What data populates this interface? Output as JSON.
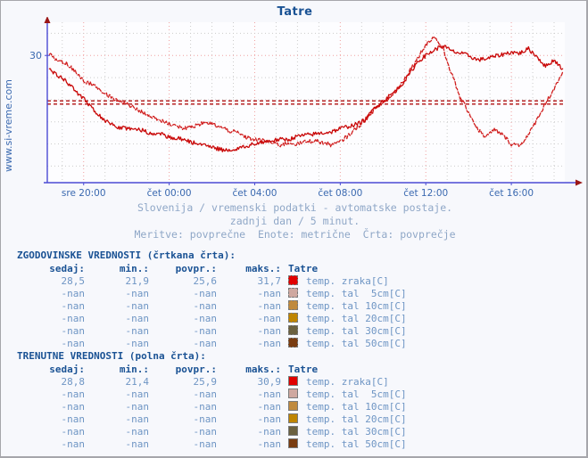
{
  "page": {
    "background": "#f7f8fc",
    "border_color": "#a6a6ab"
  },
  "header": {
    "title": "Tatre",
    "title_color": "#1a5294"
  },
  "watermark": {
    "text": "www.si-vreme.com",
    "color": "#3a69b0"
  },
  "caption": {
    "line1": "Slovenija / vremenski podatki - avtomatske postaje.",
    "line2": "zadnji dan / 5 minut.",
    "line3": "Meritve: povprečne  Enote: metrične  Črta: povprečje",
    "color": "#8fa7c7"
  },
  "tables": {
    "historical": {
      "heading": "ZGODOVINSKE VREDNOSTI (črtkana črta):",
      "line_style": "dashed",
      "columns": [
        "sedaj:",
        "min.:",
        "povpr.:",
        "maks.:"
      ],
      "series_header": "Tatre",
      "rows": [
        {
          "sedaj": "28,5",
          "min": "21,9",
          "povpr": "25,6",
          "maks": "31,7",
          "color": "#e00000",
          "label": "temp. zraka[C]"
        },
        {
          "sedaj": "-nan",
          "min": "-nan",
          "povpr": "-nan",
          "maks": "-nan",
          "color": "#cfa8a0",
          "label": "temp. tal  5cm[C]"
        },
        {
          "sedaj": "-nan",
          "min": "-nan",
          "povpr": "-nan",
          "maks": "-nan",
          "color": "#c08a3e",
          "label": "temp. tal 10cm[C]"
        },
        {
          "sedaj": "-nan",
          "min": "-nan",
          "povpr": "-nan",
          "maks": "-nan",
          "color": "#bf8500",
          "label": "temp. tal 20cm[C]"
        },
        {
          "sedaj": "-nan",
          "min": "-nan",
          "povpr": "-nan",
          "maks": "-nan",
          "color": "#6b6140",
          "label": "temp. tal 30cm[C]"
        },
        {
          "sedaj": "-nan",
          "min": "-nan",
          "povpr": "-nan",
          "maks": "-nan",
          "color": "#7a3c10",
          "label": "temp. tal 50cm[C]"
        }
      ]
    },
    "current": {
      "heading": "TRENUTNE VREDNOSTI (polna črta):",
      "line_style": "solid",
      "columns": [
        "sedaj:",
        "min.:",
        "povpr.:",
        "maks.:"
      ],
      "series_header": "Tatre",
      "rows": [
        {
          "sedaj": "28,8",
          "min": "21,4",
          "povpr": "25,9",
          "maks": "30,9",
          "color": "#e00000",
          "label": "temp. zraka[C]"
        },
        {
          "sedaj": "-nan",
          "min": "-nan",
          "povpr": "-nan",
          "maks": "-nan",
          "color": "#cfa8a0",
          "label": "temp. tal  5cm[C]"
        },
        {
          "sedaj": "-nan",
          "min": "-nan",
          "povpr": "-nan",
          "maks": "-nan",
          "color": "#c08a3e",
          "label": "temp. tal 10cm[C]"
        },
        {
          "sedaj": "-nan",
          "min": "-nan",
          "povpr": "-nan",
          "maks": "-nan",
          "color": "#bf8500",
          "label": "temp. tal 20cm[C]"
        },
        {
          "sedaj": "-nan",
          "min": "-nan",
          "povpr": "-nan",
          "maks": "-nan",
          "color": "#6b6140",
          "label": "temp. tal 30cm[C]"
        },
        {
          "sedaj": "-nan",
          "min": "-nan",
          "povpr": "-nan",
          "maks": "-nan",
          "color": "#7a3c10",
          "label": "temp. tal 50cm[C]"
        }
      ]
    }
  },
  "chart_data": {
    "type": "line",
    "title": "Tatre",
    "xlabel": "",
    "ylabel": "",
    "grid": true,
    "legend_position": "below-table",
    "x_tick_labels": [
      "sre 20:00",
      "čet 00:00",
      "čet 04:00",
      "čet 08:00",
      "čet 12:00",
      "čet 16:00"
    ],
    "x_tick_hours": [
      20,
      24,
      28,
      32,
      36,
      40
    ],
    "y_tick_labels": [
      "30"
    ],
    "y_ticks": [
      30
    ],
    "ylim": [
      18.5,
      33.0
    ],
    "xlim": [
      18.3,
      42.5
    ],
    "series": [
      {
        "name": "temp. zraka[C] (zgodovinske / črtkana črta)",
        "style": "dashed",
        "color": "#d01e1e",
        "unit": "C",
        "stats": {
          "sedaj": 28.5,
          "min": 21.9,
          "povpr": 25.6,
          "maks": 31.7
        },
        "average_line": 25.6,
        "x": [
          18.4,
          18.8,
          19.2,
          19.6,
          20.0,
          20.4,
          20.8,
          21.2,
          21.6,
          22.0,
          22.4,
          22.8,
          23.2,
          23.6,
          24.0,
          24.4,
          24.8,
          25.2,
          25.6,
          26.0,
          26.4,
          26.8,
          27.2,
          27.6,
          28.0,
          28.4,
          28.8,
          29.2,
          29.6,
          30.0,
          30.4,
          30.8,
          31.2,
          31.6,
          32.0,
          32.4,
          32.8,
          33.2,
          33.6,
          34.0,
          34.4,
          34.8,
          35.2,
          35.6,
          36.0,
          36.4,
          36.8,
          37.2,
          37.6,
          38.0,
          38.4,
          38.8,
          39.2,
          39.6,
          40.0,
          40.4,
          40.8,
          41.2,
          41.6,
          42.0,
          42.4
        ],
        "y": [
          30.1,
          29.6,
          29.3,
          28.6,
          27.7,
          27.4,
          26.9,
          26.3,
          25.9,
          25.6,
          25.3,
          24.8,
          24.4,
          24.1,
          23.8,
          23.6,
          23.4,
          23.6,
          23.9,
          23.8,
          23.5,
          23.2,
          23.0,
          22.6,
          22.4,
          22.3,
          22.1,
          21.9,
          22.1,
          22.0,
          22.2,
          22.3,
          22.1,
          21.9,
          22.2,
          22.8,
          23.5,
          24.3,
          25.1,
          25.7,
          26.3,
          27.3,
          28.5,
          29.7,
          31.0,
          31.7,
          30.6,
          28.4,
          26.2,
          24.9,
          23.4,
          22.6,
          23.3,
          22.8,
          22.0,
          21.9,
          22.8,
          24.2,
          25.7,
          27.0,
          28.5
        ]
      },
      {
        "name": "temp. zraka[C] (trenutne / polna črta)",
        "style": "solid",
        "color": "#c90808",
        "unit": "C",
        "stats": {
          "sedaj": 28.8,
          "min": 21.4,
          "povpr": 25.9,
          "maks": 30.9
        },
        "average_line": 25.9,
        "x": [
          18.4,
          18.8,
          19.2,
          19.6,
          20.0,
          20.4,
          20.8,
          21.2,
          21.6,
          22.0,
          22.4,
          22.8,
          23.2,
          23.6,
          24.0,
          24.4,
          24.8,
          25.2,
          25.6,
          26.0,
          26.4,
          26.8,
          27.2,
          27.6,
          28.0,
          28.4,
          28.8,
          29.2,
          29.6,
          30.0,
          30.4,
          30.8,
          31.2,
          31.6,
          32.0,
          32.4,
          32.8,
          33.2,
          33.6,
          34.0,
          34.4,
          34.8,
          35.2,
          35.6,
          36.0,
          36.4,
          36.8,
          37.2,
          37.6,
          38.0,
          38.4,
          38.8,
          39.2,
          39.6,
          40.0,
          40.4,
          40.8,
          41.2,
          41.6,
          42.0,
          42.4
        ],
        "y": [
          28.7,
          28.2,
          27.6,
          26.8,
          26.1,
          25.2,
          24.4,
          23.9,
          23.5,
          23.4,
          23.4,
          23.2,
          22.9,
          22.9,
          22.6,
          22.5,
          22.3,
          22.1,
          21.9,
          21.7,
          21.5,
          21.4,
          21.6,
          21.8,
          22.0,
          22.2,
          22.3,
          22.4,
          22.4,
          22.7,
          22.8,
          22.9,
          23.0,
          23.1,
          23.4,
          23.6,
          23.8,
          24.2,
          25.3,
          25.9,
          26.5,
          27.2,
          28.2,
          29.4,
          30.0,
          30.5,
          30.9,
          30.4,
          30.2,
          30.0,
          29.6,
          29.7,
          29.9,
          30.1,
          30.3,
          30.2,
          30.6,
          29.9,
          29.0,
          29.6,
          28.8
        ]
      }
    ]
  }
}
